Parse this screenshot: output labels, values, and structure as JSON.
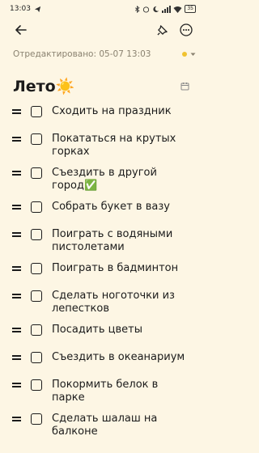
{
  "status": {
    "time": "13:03",
    "battery": "35"
  },
  "meta": {
    "edited_label": "Отредактировано: 05-07 13:03"
  },
  "note": {
    "title": "Лето☀️"
  },
  "items": [
    {
      "text": "Сходить на праздник"
    },
    {
      "text": "Покататься на крутых горках"
    },
    {
      "text": "Съездить в другой город✅"
    },
    {
      "text": "Собрать букет в вазу"
    },
    {
      "text": "Поиграть с водяными пистолетами"
    },
    {
      "text": "Поиграть в бадминтон"
    },
    {
      "text": "Сделать ноготочки из лепестков"
    },
    {
      "text": "Посадить цветы"
    },
    {
      "text": "Съездить в океанариум"
    },
    {
      "text": "Покормить белок в парке"
    },
    {
      "text": "Сделать шалаш на балконе"
    }
  ],
  "colors": {
    "background": "#fdf6e4",
    "accent": "#f0c230"
  }
}
